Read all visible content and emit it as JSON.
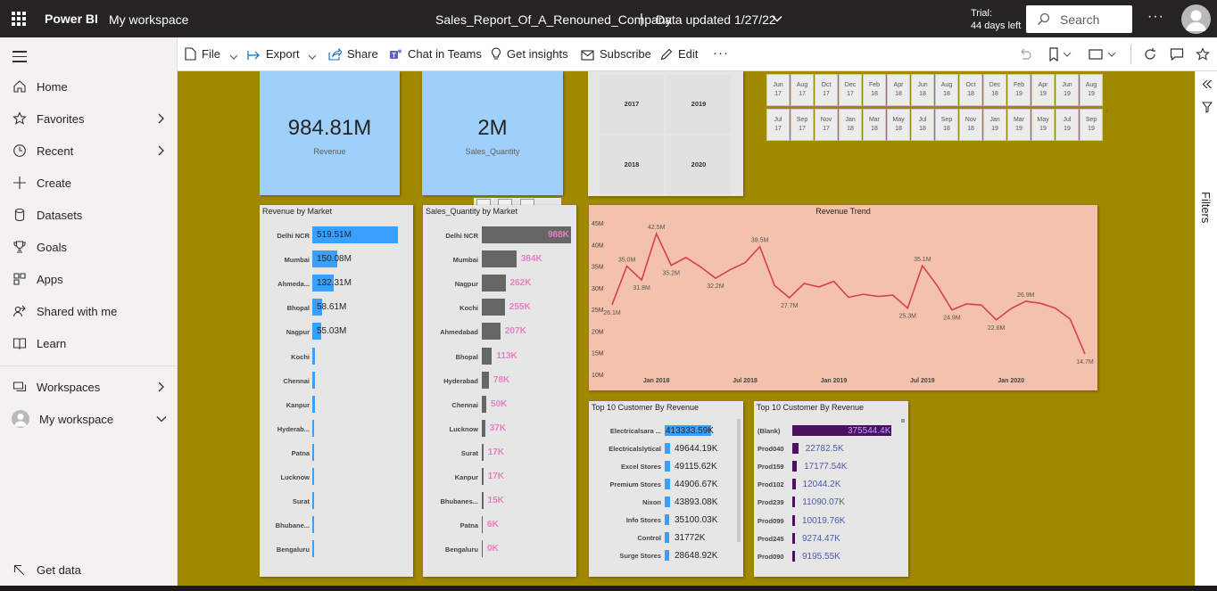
{
  "topbar": {
    "brand": "Power BI",
    "workspace": "My workspace",
    "report_title": "Sales_Report_Of_A_Renouned_Company",
    "separator": "|",
    "data_updated": "Data updated 1/27/22",
    "trial_line1": "Trial:",
    "trial_line2": "44 days left",
    "search_placeholder": "Search",
    "more": "···"
  },
  "sidebar": {
    "items": [
      {
        "label": "Home",
        "icon": "home-icon"
      },
      {
        "label": "Favorites",
        "icon": "star-icon"
      },
      {
        "label": "Recent",
        "icon": "clock-icon"
      },
      {
        "label": "Create",
        "icon": "plus-icon"
      },
      {
        "label": "Datasets",
        "icon": "database-icon"
      },
      {
        "label": "Goals",
        "icon": "trophy-icon"
      },
      {
        "label": "Apps",
        "icon": "apps-icon"
      },
      {
        "label": "Shared with me",
        "icon": "shared-icon"
      },
      {
        "label": "Learn",
        "icon": "book-icon"
      },
      {
        "label": "Workspaces",
        "icon": "workspaces-icon"
      },
      {
        "label": "My workspace",
        "icon": "avatar-icon"
      }
    ],
    "get_data": "Get data"
  },
  "commandbar": {
    "file": "File",
    "export": "Export",
    "share": "Share",
    "chat_in_teams": "Chat in Teams",
    "get_insights": "Get insights",
    "subscribe": "Subscribe",
    "edit": "Edit",
    "more": "···"
  },
  "filters_label": "Filters",
  "kpis": {
    "revenue_value": "984.81M",
    "revenue_label": "Revenue",
    "qty_value": "2M",
    "qty_label": "Sales_Quantity"
  },
  "year_slicer": [
    "2017",
    "2019",
    "2018",
    "2020"
  ],
  "month_slicer": {
    "row1": [
      [
        "Jun",
        "17"
      ],
      [
        "Aug",
        "17"
      ],
      [
        "Oct",
        "17"
      ],
      [
        "Dec",
        "17"
      ],
      [
        "Feb",
        "18"
      ],
      [
        "Apr",
        "18"
      ],
      [
        "Jun",
        "18"
      ],
      [
        "Aug",
        "18"
      ],
      [
        "Oct",
        "18"
      ],
      [
        "Dec",
        "18"
      ],
      [
        "Feb",
        "19"
      ],
      [
        "Apr",
        "19"
      ],
      [
        "Jun",
        "19"
      ],
      [
        "Aug",
        "19"
      ]
    ],
    "row2": [
      [
        "Jul",
        "17"
      ],
      [
        "Sep",
        "17"
      ],
      [
        "Nov",
        "17"
      ],
      [
        "Jan",
        "18"
      ],
      [
        "Mar",
        "18"
      ],
      [
        "May",
        "18"
      ],
      [
        "Jul",
        "18"
      ],
      [
        "Sep",
        "18"
      ],
      [
        "Nov",
        "18"
      ],
      [
        "Jan",
        "19"
      ],
      [
        "Mar",
        "19"
      ],
      [
        "May",
        "19"
      ],
      [
        "Jul",
        "19"
      ],
      [
        "Sep",
        "19"
      ]
    ]
  },
  "revenue_by_market": {
    "title": "Revenue by Market",
    "rows": [
      {
        "label": "Delhi NCR",
        "value": 519.51,
        "text": "519.51M"
      },
      {
        "label": "Mumbai",
        "value": 150.08,
        "text": "150.08M"
      },
      {
        "label": "Ahmeda...",
        "value": 132.31,
        "text": "132.31M"
      },
      {
        "label": "Bhopal",
        "value": 58.61,
        "text": "58.61M"
      },
      {
        "label": "Nagpur",
        "value": 55.03,
        "text": "55.03M"
      },
      {
        "label": "Kochi",
        "value": 18,
        "text": ""
      },
      {
        "label": "Chennai",
        "value": 16,
        "text": ""
      },
      {
        "label": "Kanpur",
        "value": 14,
        "text": ""
      },
      {
        "label": "Hyderab...",
        "value": 10,
        "text": ""
      },
      {
        "label": "Patna",
        "value": 3,
        "text": ""
      },
      {
        "label": "Lucknow",
        "value": 2,
        "text": ""
      },
      {
        "label": "Surat",
        "value": 2,
        "text": ""
      },
      {
        "label": "Bhubane...",
        "value": 1.5,
        "text": ""
      },
      {
        "label": "Bengaluru",
        "value": 1,
        "text": ""
      }
    ]
  },
  "qty_by_market": {
    "title": "Sales_Quantity by Market",
    "rows": [
      {
        "label": "Delhi NCR",
        "value": 988,
        "text": "988K"
      },
      {
        "label": "Mumbai",
        "value": 384,
        "text": "384K"
      },
      {
        "label": "Nagpur",
        "value": 262,
        "text": "262K"
      },
      {
        "label": "Kochi",
        "value": 255,
        "text": "255K"
      },
      {
        "label": "Ahmedabad",
        "value": 207,
        "text": "207K"
      },
      {
        "label": "Bhopal",
        "value": 113,
        "text": "113K"
      },
      {
        "label": "Hyderabad",
        "value": 78,
        "text": "78K"
      },
      {
        "label": "Chennai",
        "value": 50,
        "text": "50K"
      },
      {
        "label": "Lucknow",
        "value": 37,
        "text": "37K"
      },
      {
        "label": "Surat",
        "value": 17,
        "text": "17K"
      },
      {
        "label": "Kanpur",
        "value": 17,
        "text": "17K"
      },
      {
        "label": "Bhubanes...",
        "value": 15,
        "text": "15K"
      },
      {
        "label": "Patna",
        "value": 6,
        "text": "6K"
      },
      {
        "label": "Bengaluru",
        "value": 0,
        "text": "0K"
      }
    ]
  },
  "chart_data": {
    "type": "line",
    "title": "Revenue Trend",
    "ylim": [
      10,
      45
    ],
    "ytick_labels": [
      "45M",
      "40M",
      "35M",
      "30M",
      "25M",
      "20M",
      "15M",
      "10M"
    ],
    "xtick_labels": [
      "Jan 2018",
      "Jul 2018",
      "Jan 2019",
      "Jul 2019",
      "Jan 2020"
    ],
    "x": [
      "2017-10",
      "2017-11",
      "2017-12",
      "2018-01",
      "2018-02",
      "2018-03",
      "2018-04",
      "2018-05",
      "2018-06",
      "2018-07",
      "2018-08",
      "2018-09",
      "2018-10",
      "2018-11",
      "2018-12",
      "2019-01",
      "2019-02",
      "2019-03",
      "2019-04",
      "2019-05",
      "2019-06",
      "2019-07",
      "2019-08",
      "2019-09",
      "2019-10",
      "2019-11",
      "2019-12",
      "2020-01",
      "2020-02",
      "2020-03",
      "2020-04",
      "2020-05",
      "2020-06"
    ],
    "series": [
      {
        "color": "#d6404e",
        "values": [
          26.1,
          35.0,
          31.8,
          42.5,
          35.2,
          37.0,
          34.8,
          32.2,
          34.2,
          35.8,
          39.5,
          30.5,
          27.7,
          31.0,
          30.2,
          31.5,
          27.8,
          28.5,
          28.0,
          28.3,
          25.3,
          35.1,
          30.5,
          24.9,
          26.3,
          26.0,
          22.6,
          25.2,
          26.9,
          26.4,
          25.3,
          22.8,
          14.7
        ]
      }
    ],
    "data_labels": [
      {
        "i": 0,
        "text": "26.1M"
      },
      {
        "i": 1,
        "text": "35.0M"
      },
      {
        "i": 2,
        "text": "31.8M"
      },
      {
        "i": 3,
        "text": "42.5M"
      },
      {
        "i": 4,
        "text": "35.2M"
      },
      {
        "i": 7,
        "text": "32.2M"
      },
      {
        "i": 10,
        "text": "39.5M"
      },
      {
        "i": 12,
        "text": "27.7M"
      },
      {
        "i": 20,
        "text": "25.3M"
      },
      {
        "i": 21,
        "text": "35.1M"
      },
      {
        "i": 23,
        "text": "24.9M"
      },
      {
        "i": 26,
        "text": "22.6M"
      },
      {
        "i": 28,
        "text": "26.9M"
      },
      {
        "i": 32,
        "text": "14.7M"
      }
    ]
  },
  "top_customers": {
    "title": "Top 10 Customer By Revenue",
    "rows": [
      {
        "label": "Electricalsara ...",
        "value": 413333.59,
        "text": "413333.59K"
      },
      {
        "label": "Electricalslytical",
        "value": 49644.19,
        "text": "49644.19K"
      },
      {
        "label": "Excel Stores",
        "value": 49115.62,
        "text": "49115.62K"
      },
      {
        "label": "Premium Stores",
        "value": 44906.67,
        "text": "44906.67K"
      },
      {
        "label": "Nixon",
        "value": 43893.08,
        "text": "43893.08K"
      },
      {
        "label": "Info Stores",
        "value": 35100.03,
        "text": "35100.03K"
      },
      {
        "label": "Control",
        "value": 31772,
        "text": "31772K"
      },
      {
        "label": "Surge Stores",
        "value": 28648.92,
        "text": "28648.92K"
      }
    ]
  },
  "top_products": {
    "title": "Top 10 Customer By Revenue",
    "rows": [
      {
        "label": "(Blank)",
        "value": 375544.4,
        "text": "375544.4K"
      },
      {
        "label": "Prod040",
        "value": 22782.5,
        "text": "22782.5K"
      },
      {
        "label": "Prod159",
        "value": 17177.54,
        "text": "17177.54K"
      },
      {
        "label": "Prod102",
        "value": 12044.2,
        "text": "12044.2K"
      },
      {
        "label": "Prod239",
        "value": 11090.07,
        "text": "11090.07K"
      },
      {
        "label": "Prod099",
        "value": 10019.76,
        "text": "10019.76K"
      },
      {
        "label": "Prod245",
        "value": 9274.47,
        "text": "9274.47K"
      },
      {
        "label": "Prod090",
        "value": 9195.55,
        "text": "9195.55K"
      }
    ]
  }
}
